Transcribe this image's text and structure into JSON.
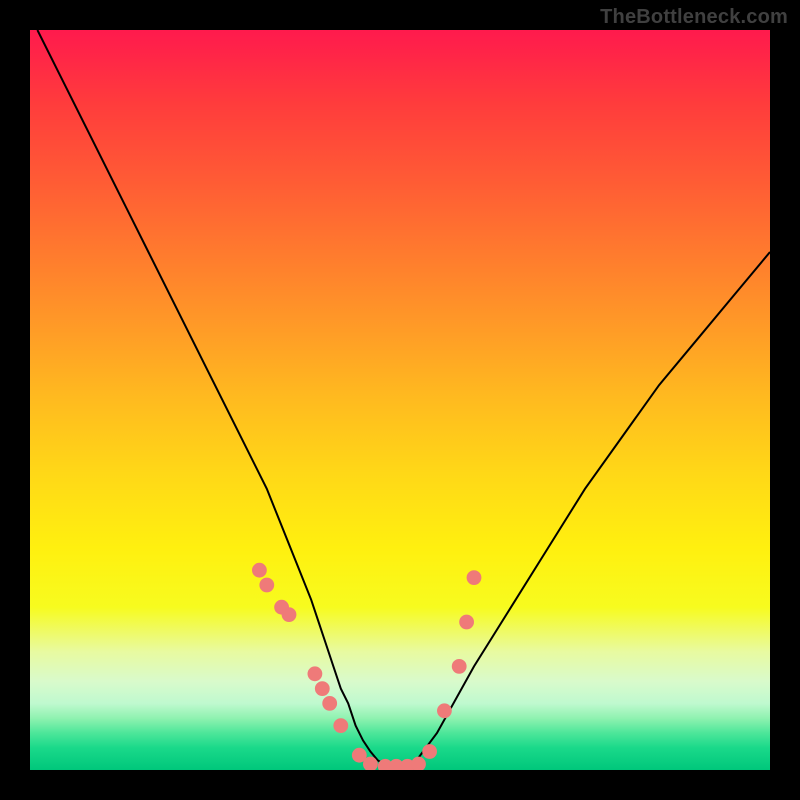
{
  "watermark": "TheBottleneck.com",
  "chart_data": {
    "type": "line",
    "title": "",
    "xlabel": "",
    "ylabel": "",
    "xlim": [
      0,
      100
    ],
    "ylim": [
      0,
      100
    ],
    "grid": false,
    "legend": false,
    "series": [
      {
        "name": "curve",
        "color": "#000000",
        "x": [
          1,
          4,
          8,
          12,
          16,
          20,
          24,
          28,
          32,
          34,
          36,
          38,
          39,
          40,
          41,
          42,
          43,
          44,
          45,
          46,
          47,
          48,
          49,
          50,
          51,
          52,
          55,
          60,
          65,
          70,
          75,
          80,
          85,
          90,
          95,
          100
        ],
        "values": [
          100,
          94,
          86,
          78,
          70,
          62,
          54,
          46,
          38,
          33,
          28,
          23,
          20,
          17,
          14,
          11,
          9,
          6,
          4,
          2.5,
          1.3,
          0.7,
          0.5,
          0.5,
          0.5,
          1.0,
          5,
          14,
          22,
          30,
          38,
          45,
          52,
          58,
          64,
          70
        ]
      }
    ],
    "markers": {
      "name": "dots",
      "color": "#ef7a79",
      "radius_pct": 1.0,
      "x": [
        31,
        32,
        34,
        35,
        38.5,
        39.5,
        40.5,
        42,
        44.5,
        46,
        48,
        49.5,
        51,
        52.5,
        54,
        56,
        58,
        59,
        60
      ],
      "values": [
        27,
        25,
        22,
        21,
        13,
        11,
        9,
        6,
        2,
        0.8,
        0.5,
        0.5,
        0.5,
        0.8,
        2.5,
        8,
        14,
        20,
        26
      ]
    }
  }
}
